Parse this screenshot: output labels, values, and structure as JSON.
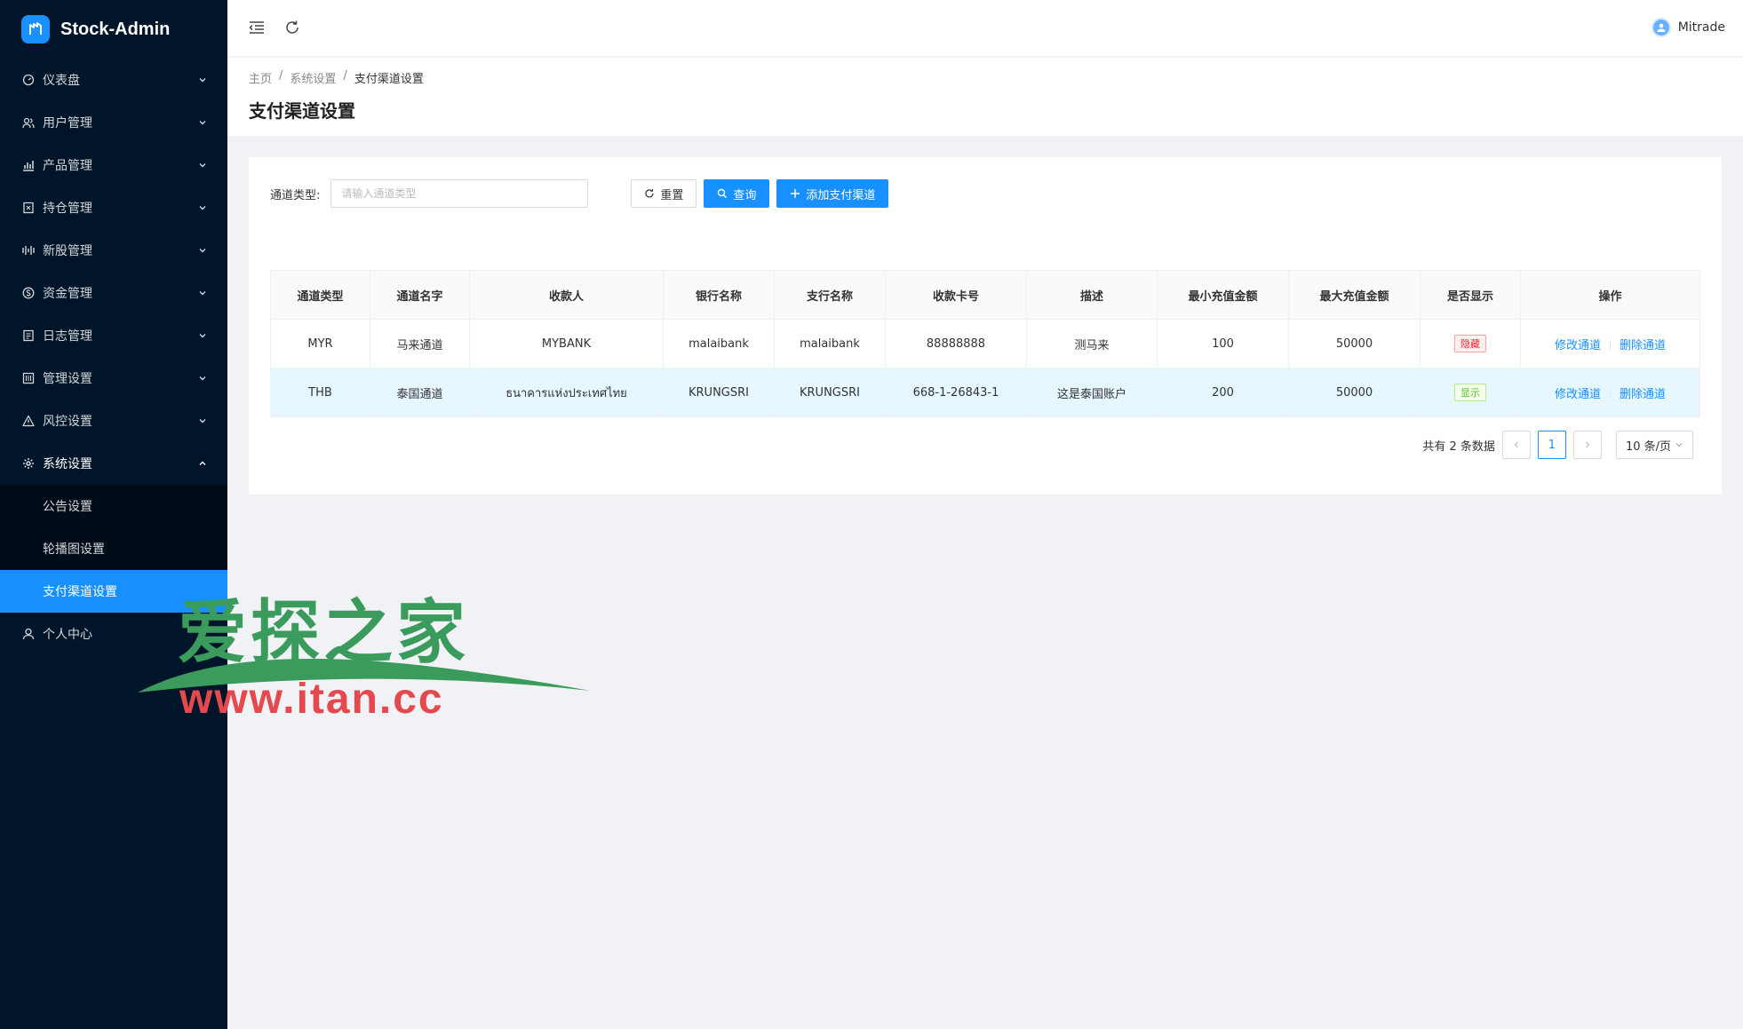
{
  "app": {
    "title": "Stock-Admin"
  },
  "sidebar": {
    "items": [
      {
        "label": "仪表盘",
        "icon": "dashboard-icon"
      },
      {
        "label": "用户管理",
        "icon": "users-icon"
      },
      {
        "label": "产品管理",
        "icon": "chart-icon"
      },
      {
        "label": "持仓管理",
        "icon": "holding-icon"
      },
      {
        "label": "新股管理",
        "icon": "ipo-icon"
      },
      {
        "label": "资金管理",
        "icon": "money-icon"
      },
      {
        "label": "日志管理",
        "icon": "log-icon"
      },
      {
        "label": "管理设置",
        "icon": "admin-icon"
      },
      {
        "label": "风控设置",
        "icon": "warning-icon"
      },
      {
        "label": "系统设置",
        "icon": "gear-icon"
      },
      {
        "label": "个人中心",
        "icon": "user-icon"
      }
    ],
    "submenu": [
      {
        "label": "公告设置"
      },
      {
        "label": "轮播图设置"
      },
      {
        "label": "支付渠道设置"
      }
    ]
  },
  "header": {
    "user_name": "Mitrade"
  },
  "breadcrumb": {
    "home": "主页",
    "parent": "系统设置",
    "current": "支付渠道设置",
    "sep": "/"
  },
  "page": {
    "title": "支付渠道设置"
  },
  "search": {
    "label": "通道类型:",
    "placeholder": "请输入通道类型",
    "reset_label": "重置",
    "query_label": "查询",
    "add_label": "添加支付渠道"
  },
  "table": {
    "headers": [
      "通道类型",
      "通道名字",
      "收款人",
      "银行名称",
      "支行名称",
      "收款卡号",
      "描述",
      "最小充值金额",
      "最大充值金额",
      "是否显示",
      "操作"
    ],
    "rows": [
      {
        "type": "MYR",
        "name": "马来通道",
        "payee": "MYBANK",
        "bank": "malaibank",
        "branch": "malaibank",
        "card": "88888888",
        "desc": "测马来",
        "min": "100",
        "max": "50000",
        "visible": "隐藏",
        "edit": "修改通道",
        "del": "删除通道"
      },
      {
        "type": "THB",
        "name": "泰国通道",
        "payee": "ธนาคารแห่งประเทศไทย",
        "bank": "KRUNGSRI",
        "branch": "KRUNGSRI",
        "card": "668-1-26843-1",
        "desc": "这是泰国账户",
        "min": "200",
        "max": "50000",
        "visible": "显示",
        "edit": "修改通道",
        "del": "删除通道"
      }
    ]
  },
  "pagination": {
    "total_text": "共有 2 条数据",
    "current_page": "1",
    "page_size": "10 条/页"
  },
  "watermark": {
    "cn": "爱探之家",
    "en": "www.itan.cc"
  },
  "colors": {
    "sidebar_bg": "#001529",
    "primary": "#1890ff",
    "danger": "#f5222d",
    "success": "#52c41a"
  }
}
